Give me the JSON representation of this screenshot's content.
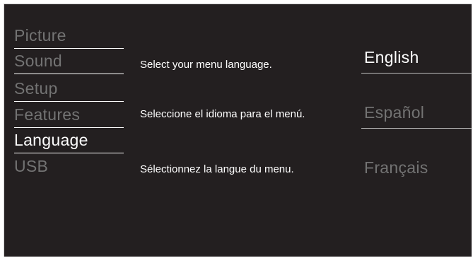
{
  "menu": {
    "items": [
      {
        "label": "Picture"
      },
      {
        "label": "Sound"
      },
      {
        "label": "Setup"
      },
      {
        "label": "Features"
      },
      {
        "label": "Language"
      },
      {
        "label": "USB"
      }
    ],
    "active": "Language"
  },
  "language": {
    "prompts": [
      {
        "text": "Select your menu language."
      },
      {
        "text": "Seleccione el idioma para el menú."
      },
      {
        "text": "Sélectionnez la langue du menu."
      }
    ],
    "options": [
      {
        "label": "English"
      },
      {
        "label": "Español"
      },
      {
        "label": "Français"
      }
    ],
    "selected": "English"
  },
  "colors": {
    "background": "#231f20",
    "active_text": "#ffffff",
    "inactive_text": "#737373"
  }
}
